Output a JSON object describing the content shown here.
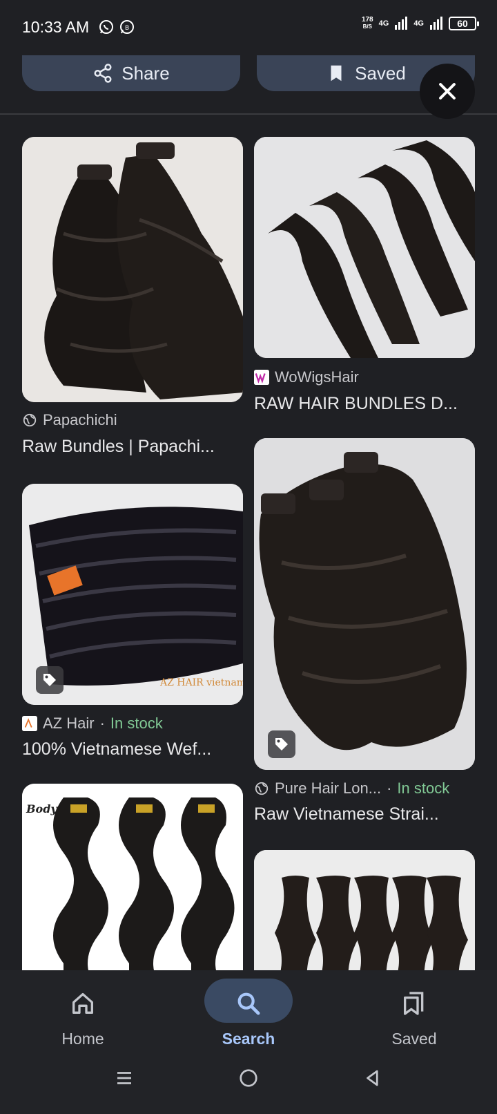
{
  "status_bar": {
    "time": "10:33 AM",
    "speed_value": "178",
    "speed_unit": "B/S",
    "net1": "4G",
    "net2": "4G",
    "battery": "60"
  },
  "actions": {
    "share_label": "Share",
    "saved_label": "Saved"
  },
  "results": [
    {
      "source": "Papachichi",
      "title": "Raw Bundles | Papachi...",
      "in_stock": "",
      "has_tag": false
    },
    {
      "source": "WoWigsHair",
      "title": "RAW HAIR BUNDLES D...",
      "in_stock": "",
      "has_tag": false
    },
    {
      "source": "AZ Hair",
      "title": "100% Vietnamese Wef...",
      "in_stock": "In stock",
      "has_tag": true,
      "watermark": "AZ HAIR vietnam"
    },
    {
      "source": "Pure Hair Lon...",
      "title": "Raw Vietnamese Strai...",
      "in_stock": "In stock",
      "has_tag": true
    },
    {
      "source": "",
      "title": "",
      "in_stock": "",
      "has_tag": false,
      "overlay_text": "Body Wave"
    },
    {
      "source": "",
      "title": "",
      "in_stock": "",
      "has_tag": false
    }
  ],
  "bottom_nav": {
    "home_label": "Home",
    "search_label": "Search",
    "saved_label": "Saved"
  },
  "icons": {
    "share": "share-icon",
    "bookmark": "bookmark-icon",
    "close": "close-icon",
    "globe": "globe-icon",
    "tag": "tag-icon",
    "home": "home-icon",
    "search": "search-icon",
    "saved": "bookmarks-icon"
  },
  "colors": {
    "background": "#1f2024",
    "pill": "#3a4457",
    "active_nav": "#a8c7fa",
    "in_stock": "#81c995"
  }
}
